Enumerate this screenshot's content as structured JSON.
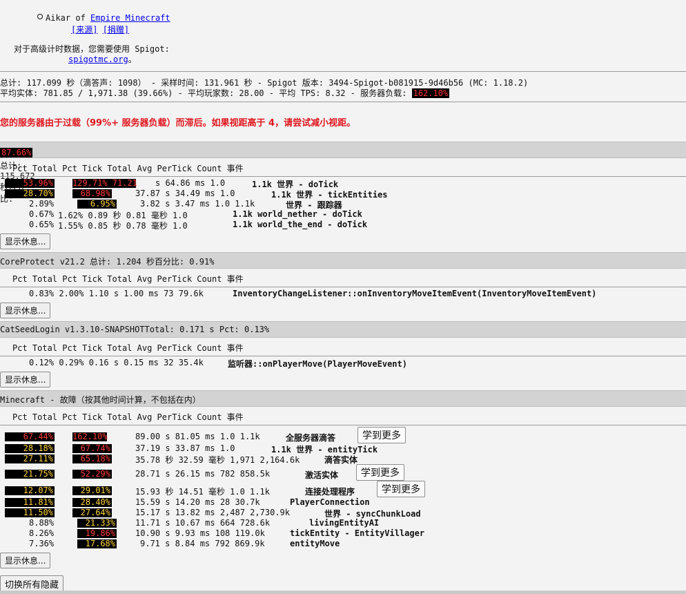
{
  "header": {
    "author_prefix": "Aikar of ",
    "author_link": "Empire Minecraft",
    "source_link": "[来源]",
    "donate_link": "[捐赠]",
    "spigot_note": "对于高级计时数据，您需要使用 Spigot:",
    "spigot_link": "spigotmc.org",
    "spigot_suffix": "。"
  },
  "summary": {
    "line1": "总计: 117.099 秒（滴答声: 1098） - 采样时间: 131.961 秒 - Spigot 版本: 3494-Spigot-b081915-9d46b56 (MC: 1.18.2)",
    "line2_prefix": "平均实体: 781.85 / 1,971.38 (39.66%) - 平均玩家数: 28.00 - 平均 TPS: 8.32 - 服务器负载: ",
    "server_load": "162.10%"
  },
  "warning": "您的服务器由于过载（99%+ 服务器负载）而滞后。如果视距高于 4，请尝试减小视距。",
  "columns": "Pct Total Pct Tick Total Avg PerTick Count 事件",
  "show_rest": "显示休息...",
  "learn_more": "学到更多",
  "toggle_hidden": "切换所有隐藏",
  "sections": [
    {
      "title_prefix": "我的世界总计: 115.672 秒百分比: ",
      "title_pct": "87.66%",
      "rows": [
        {
          "pct": "53.96%",
          "pct_style": "red",
          "tick": "129.71% 71.21",
          "tick_style": "red",
          "rest": "s 64.86 ms 1.0",
          "event": "1.1k 世界 - doTick"
        },
        {
          "pct": "28.70%",
          "pct_style": "yellow",
          "tick": "68.98%",
          "tick_style": "red",
          "rest": "37.87 s 34.49 ms 1.0",
          "event": "1.1k 世界 - tickEntities"
        },
        {
          "pct": "2.89%",
          "pct_style": "plain",
          "tick": "6.95%",
          "tick_style": "yellow",
          "rest": "3.82 s 3.47 ms 1.0 1.1k",
          "event": "世界 - 跟踪器"
        },
        {
          "pct": "0.67%",
          "pct_style": "plain",
          "tick": "1.62% 0.89 秒 0.81 毫秒 1.0",
          "tick_style": "plain",
          "rest": "",
          "event": "1.1k world_nether - doTick"
        },
        {
          "pct": "0.65%",
          "pct_style": "plain",
          "tick": "1.55% 0.85 秒 0.78 毫秒 1.0",
          "tick_style": "plain",
          "rest": "",
          "event": "1.1k world_the_end - doTick"
        }
      ]
    },
    {
      "title_prefix": "CoreProtect v21.2 总计: 1.204 秒百分比: 0.91%",
      "rows": [
        {
          "text": "0.83% 2.00% 1.10 s 1.00 ms 73 79.6k",
          "event": "InventoryChangeListener::onInventoryMoveItemEvent(InventoryMoveItemEvent)"
        }
      ]
    },
    {
      "title_prefix": "CatSeedLogin v1.3.10-SNAPSHOTTotal: 0.171 s Pct: 0.13%",
      "rows": [
        {
          "text": "0.12% 0.29% 0.16 s 0.15 ms 32 35.4k",
          "event": "监听器::onPlayerMove(PlayerMoveEvent)"
        }
      ]
    },
    {
      "title_prefix": "Minecraft - 故障（按其他时间计算，不包括在内）",
      "rows": [
        {
          "pct": "67.44%",
          "pct_style": "red",
          "tick": "162.10%",
          "tick_style": "red",
          "rest": "89.00 s 81.05 ms 1.0 1.1k",
          "event": "全服务器滴答",
          "learn": true
        },
        {
          "pct": "28.18%",
          "pct_style": "yellow",
          "tick": "67.74%",
          "tick_style": "red",
          "rest": "37.19 s 33.87 ms 1.0",
          "event": "1.1k 世界 - entityTick"
        },
        {
          "pct": "27.11%",
          "pct_style": "yellow",
          "tick": "65.18%",
          "tick_style": "red",
          "rest": "35.78 秒 32.59 毫秒 1,971 2,164.6k",
          "event": "滴答实体"
        },
        {
          "pct": "21.75%",
          "pct_style": "yellow",
          "tick": "52.29%",
          "tick_style": "red",
          "rest": "28.71 s 26.15 ms 782 858.5k",
          "event": "激活实体",
          "learn": true
        },
        {
          "pct": "12.07%",
          "pct_style": "yellow",
          "tick": "29.01%",
          "tick_style": "yellow",
          "rest": "15.93 秒 14.51 毫秒 1.0 1.1k",
          "event": "连接处理程序",
          "learn": true
        },
        {
          "pct": "11.81%",
          "pct_style": "yellow",
          "tick": "28.40%",
          "tick_style": "yellow",
          "rest": "15.59 s 14.20 ms 28 30.7k",
          "event": "PlayerConnection"
        },
        {
          "pct": "11.50%",
          "pct_style": "yellow",
          "tick": "27.64%",
          "tick_style": "yellow",
          "rest": "15.17 s 13.82 ms 2,487 2,730.9k",
          "event": "世界 - syncChunkLoad"
        },
        {
          "pct": "8.88%",
          "pct_style": "plain",
          "tick": "21.33%",
          "tick_style": "yellow",
          "rest": "11.71 s 10.67 ms 664 728.6k",
          "event": "livingEntityAI"
        },
        {
          "pct": "8.26%",
          "pct_style": "plain",
          "tick": "19.86%",
          "tick_style": "red",
          "rest": "10.90 s 9.93 ms 108 119.0k",
          "event": "tickEntity - EntityVillager"
        },
        {
          "pct": "7.36%",
          "pct_style": "plain",
          "tick": "17.68%",
          "tick_style": "yellow",
          "rest": "9.71 s 8.84 ms 792 869.9k",
          "event": "entityMove"
        }
      ]
    }
  ]
}
